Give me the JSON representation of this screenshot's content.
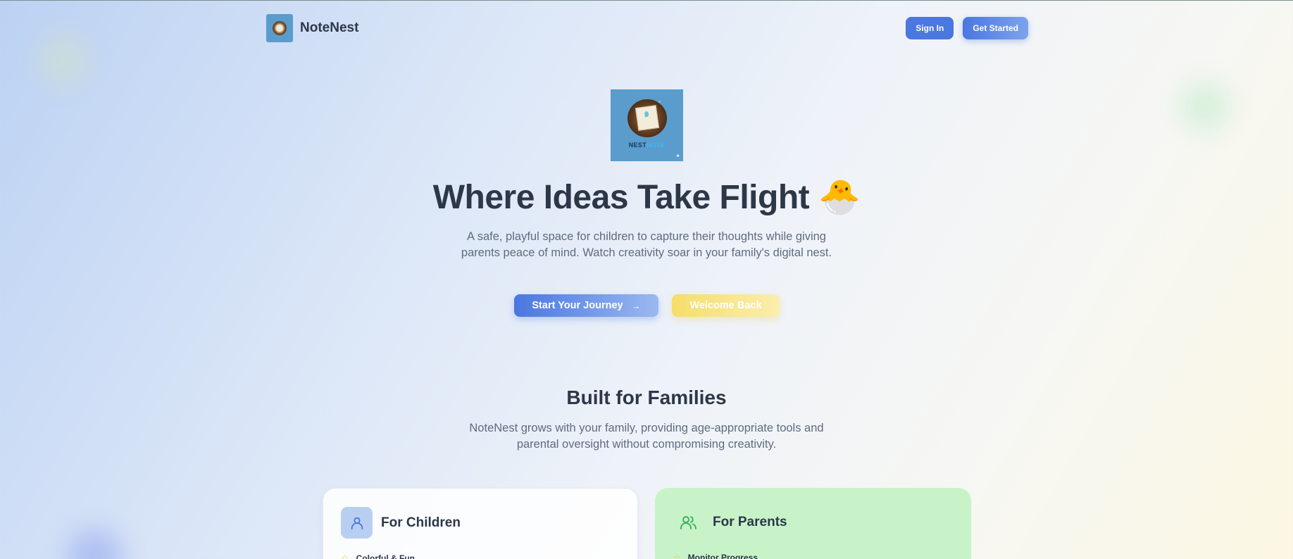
{
  "header": {
    "brand_name": "NoteNest",
    "sign_in_label": "Sign In",
    "get_started_label": "Get Started"
  },
  "hero": {
    "logo_text_primary": "NEST",
    "logo_text_secondary": "NOTE",
    "title": "Where Ideas Take Flight 🐣",
    "subtitle": "A safe, playful space for children to capture their thoughts while giving parents peace of mind. Watch creativity soar in your family's digital nest.",
    "start_label": "Start Your Journey",
    "start_icon": "→",
    "welcome_label": "Welcome Back"
  },
  "families": {
    "title": "Built for Families",
    "subtitle": "NoteNest grows with your family, providing age-appropriate tools and parental oversight without compromising creativity."
  },
  "cards": {
    "children": {
      "title": "For Children",
      "icon": "user-icon",
      "first_item": "Colorful & Fun"
    },
    "parents": {
      "title": "For Parents",
      "icon": "users-icon",
      "first_item": "Monitor Progress"
    }
  },
  "colors": {
    "primary": "#4a77e0",
    "accent_yellow": "#f6dd6a",
    "parents_card": "#c8f3c9",
    "text_dark": "#2d3748"
  }
}
